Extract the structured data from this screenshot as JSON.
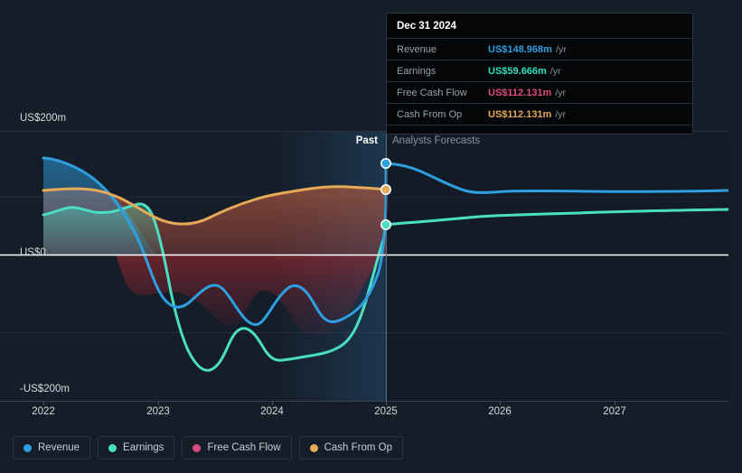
{
  "theme": {
    "background": "#151d28",
    "zero_line": "#ffffff",
    "grid": "#2a323e",
    "axis_text": "#d7dbe0"
  },
  "bands": {
    "past_label": "Past",
    "forecast_label": "Analysts Forecasts",
    "divider_x": 427
  },
  "tooltip": {
    "date": "Dec 31 2024",
    "rows": [
      {
        "label": "Revenue",
        "value": "US$148.968m",
        "unit": "/yr",
        "color": "#2e9fe0"
      },
      {
        "label": "Earnings",
        "value": "US$59.666m",
        "unit": "/yr",
        "color": "#2ee0bb"
      },
      {
        "label": "Free Cash Flow",
        "value": "US$112.131m",
        "unit": "/yr",
        "color": "#e0487f"
      },
      {
        "label": "Cash From Op",
        "value": "US$112.131m",
        "unit": "/yr",
        "color": "#e8a martial"
      }
    ]
  },
  "legend": [
    {
      "label": "Revenue",
      "color": "#2e9fe0",
      "icon": "legend-dot-icon"
    },
    {
      "label": "Earnings",
      "color": "#49dfc0",
      "icon": "legend-dot-icon"
    },
    {
      "label": "Free Cash Flow",
      "color": "#d64a80",
      "icon": "legend-dot-icon"
    },
    {
      "label": "Cash From Op",
      "color": "#e5a957",
      "icon": "legend-dot-icon"
    }
  ],
  "chart_data": {
    "type": "area",
    "title": "",
    "xlabel": "",
    "ylabel": "",
    "ylim": [
      -200,
      200
    ],
    "yticks": [
      200,
      0,
      -200
    ],
    "ytick_labels": [
      "US$200m",
      "US$0",
      "-US$200m"
    ],
    "xticks": [
      2022,
      2023,
      2024,
      2025,
      2026,
      2027
    ],
    "xtick_labels": [
      "2022",
      "2023",
      "2024",
      "2025",
      "2026",
      "2027"
    ],
    "grid": true,
    "legend_position": "bottom-left",
    "forecast_start": 2025,
    "units": "US$ millions per year",
    "annotations": [
      {
        "text": "Past",
        "x": 2024.8
      },
      {
        "text": "Analysts Forecasts",
        "x": 2025.1
      }
    ],
    "markers": [
      {
        "series": "Revenue",
        "x": 2025,
        "y": 148.968
      },
      {
        "series": "Cash From Op",
        "x": 2025,
        "y": 112.131
      },
      {
        "series": "Earnings",
        "x": 2025,
        "y": 59.666
      }
    ],
    "series": [
      {
        "name": "Revenue",
        "color": "#2e9fe0",
        "x": [
          2022.0,
          2022.25,
          2022.5,
          2022.75,
          2023.0,
          2023.2,
          2023.4,
          2023.6,
          2023.8,
          2024.0,
          2024.2,
          2024.5,
          2024.75,
          2025.0,
          2025.3,
          2025.6,
          2026.0,
          2026.5,
          2027.0,
          2027.5,
          2027.95
        ],
        "values": [
          168,
          152,
          120,
          20,
          -95,
          -122,
          -112,
          -108,
          -130,
          -88,
          -118,
          -50,
          65,
          148.968,
          130,
          108,
          98,
          97,
          98,
          101,
          105
        ]
      },
      {
        "name": "Earnings",
        "color": "#49dfc0",
        "x": [
          2022.0,
          2022.25,
          2022.5,
          2022.75,
          2023.0,
          2023.2,
          2023.4,
          2023.6,
          2023.8,
          2024.0,
          2024.2,
          2024.5,
          2024.8,
          2025.0,
          2025.4,
          2026.0,
          2026.6,
          2027.2,
          2027.95
        ],
        "values": [
          75,
          90,
          78,
          82,
          -110,
          -140,
          -200,
          -160,
          -190,
          -150,
          -152,
          -120,
          35,
          59.666,
          70,
          76,
          80,
          84,
          90
        ]
      },
      {
        "name": "Free Cash Flow",
        "color": "#d64a80",
        "x": [
          2022.0,
          2022.5,
          2023.0,
          2023.5,
          2024.0,
          2024.5,
          2025.0
        ],
        "values": [
          130,
          128,
          108,
          96,
          118,
          130,
          112.131
        ]
      },
      {
        "name": "Cash From Op",
        "color": "#e5a957",
        "x": [
          2022.0,
          2022.3,
          2022.6,
          2023.0,
          2023.3,
          2023.6,
          2024.0,
          2024.4,
          2024.7,
          2025.0
        ],
        "values": [
          130,
          131,
          128,
          108,
          94,
          100,
          110,
          122,
          126,
          112.131
        ]
      }
    ]
  }
}
